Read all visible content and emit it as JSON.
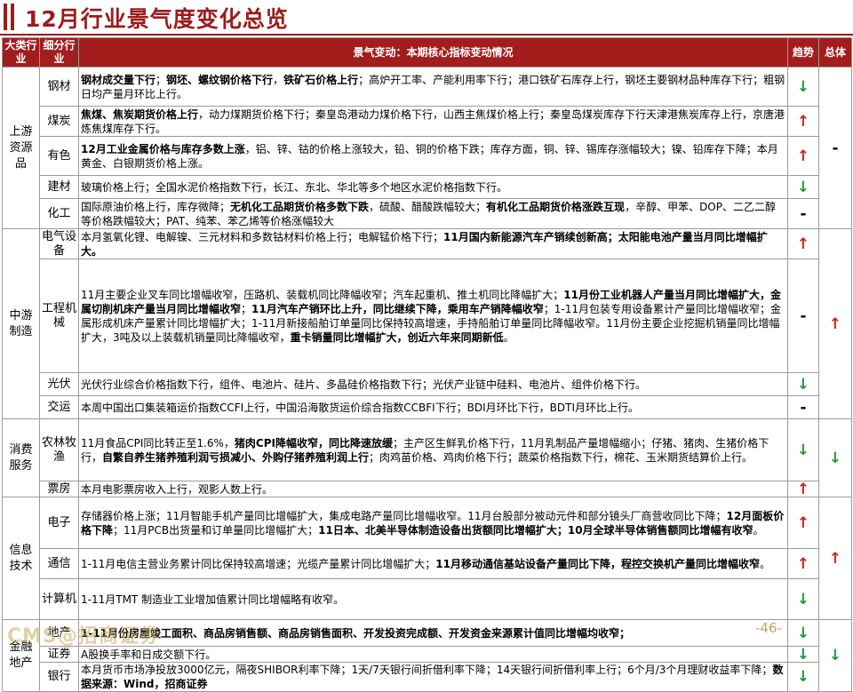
{
  "title": "12月行业景气度变化总览",
  "header": {
    "major": "大类行业",
    "minor": "细分行业",
    "desc": "景气变动：本期核心指标变动情况",
    "trend": "趋势",
    "total": "总体"
  },
  "rows": [
    {
      "major": "上游资源品",
      "major_span": 5,
      "minor": "钢材",
      "h": 44,
      "trend": "↓",
      "trend_class": "down",
      "total": "-",
      "total_class": "flat",
      "total_span": 5,
      "segs": [
        {
          "t": "钢材成交量下行",
          "b": true
        },
        {
          "t": "；",
          "b": false
        },
        {
          "t": "钢坯、螺纹钢价格下行",
          "b": true
        },
        {
          "t": "，",
          "b": false
        },
        {
          "t": "铁矿石价格上行",
          "b": true
        },
        {
          "t": "；高炉开工率、产能利用率下行；港口铁矿石库存上行，钢坯主要钢材品种库存下行；粗钢日均产量月环比上行。",
          "b": false
        }
      ]
    },
    {
      "minor": "煤炭",
      "h": 34,
      "trend": "↑",
      "trend_class": "up",
      "segs": [
        {
          "t": "焦煤、焦炭期货价格上行",
          "b": true
        },
        {
          "t": "，动力煤期货价格下行；秦皇岛港动力煤价格下行，山西主焦煤价格上行；秦皇岛煤炭库存下行天津港焦炭库存上行，京唐港炼焦煤库存下行。",
          "b": false
        }
      ]
    },
    {
      "minor": "有色",
      "h": 44,
      "trend": "↑",
      "trend_class": "up",
      "segs": [
        {
          "t": "12月工业金属价格与库存多数上涨",
          "b": true
        },
        {
          "t": "，铝、锌、钴的价格上涨较大，铅、铜的价格下跌；库存方面，铜、锌、锡库存涨幅较大；镍、铅库存下降；本月黄金、白银期货价格上涨。",
          "b": false
        }
      ]
    },
    {
      "minor": "建材",
      "h": 26,
      "trend": "↓",
      "trend_class": "down",
      "segs": [
        {
          "t": "玻璃价格上行；全国水泥价格指数下行，长江、东北、华北等多个地区水泥价格指数下行。",
          "b": false
        }
      ]
    },
    {
      "minor": "化工",
      "h": 34,
      "trend": "-",
      "trend_class": "flat",
      "segs": [
        {
          "t": "国际原油价格上行，库存微降；",
          "b": false
        },
        {
          "t": "无机化工品期货价格多数下跌",
          "b": true
        },
        {
          "t": "，硫酸、醋酸跌幅较大；",
          "b": false
        },
        {
          "t": "有机化工品期货价格涨跌互现",
          "b": true
        },
        {
          "t": "，辛醇、甲苯、DOP、二乙二醇等价格跌幅较大；PAT、纯苯、苯乙烯等价格涨幅较大",
          "b": false
        }
      ]
    },
    {
      "major": "中游制造",
      "major_span": 4,
      "minor": "电气设备",
      "h": 34,
      "trend": "↑",
      "trend_class": "up",
      "total": "↑",
      "total_class": "up",
      "total_span": 4,
      "segs": [
        {
          "t": "本月氢氧化锂、电解镍、三元材料和多数钴材料价格上行；电解锰价格下行；",
          "b": false
        },
        {
          "t": "11月国内新能源汽车产销续创新高；太阳能电池产量当月同比增幅扩大。",
          "b": true
        }
      ]
    },
    {
      "minor": "工程机械",
      "h": 128,
      "trend": "-",
      "trend_class": "flat",
      "segs": [
        {
          "t": "11月主要企业叉车同比增幅收窄，压路机、装载机同比降幅收窄；汽车起重机、推土机同比降幅扩大；",
          "b": false
        },
        {
          "t": "11月份工业机器人产量当月同比增幅扩大，金属切削机床产量当月同比增幅收窄",
          "b": true
        },
        {
          "t": "；",
          "b": false
        },
        {
          "t": "11月汽车产销环比上升，同比继续下降，乘用车产销降幅收窄",
          "b": true
        },
        {
          "t": "；1-11月包装专用设备累计产量同比增幅收窄；金属形成机床产量累计同比增幅扩大；1-11月新接船舶订单量同比保持较高增速，手持船舶订单量同比降幅收窄。11月份主要企业挖掘机销量同比增幅扩大，3吨及以上装载机销量同比降幅收窄，",
          "b": false
        },
        {
          "t": "重卡销量同比增幅扩大，创近六年来同期新低",
          "b": true
        },
        {
          "t": "。",
          "b": false
        }
      ]
    },
    {
      "minor": "光伏",
      "h": 26,
      "trend": "↓",
      "trend_class": "down",
      "segs": [
        {
          "t": "光伏行业综合价格指数下行，组件、电池片、硅片、多晶硅价格指数下行；光伏产业链中硅料、电池片、组件价格下行。",
          "b": false
        }
      ]
    },
    {
      "minor": "交运",
      "h": 26,
      "trend": "-",
      "trend_class": "flat",
      "segs": [
        {
          "t": "本周中国出口集装箱运价指数CCFI上行，中国沿海散货运价综合指数CCBFI下行；BDI月环比下行，BDTI月环比上行。",
          "b": false
        }
      ]
    },
    {
      "major": "消费服务",
      "major_span": 2,
      "minor": "农林牧渔",
      "h": 70,
      "trend": "↓",
      "trend_class": "down",
      "total": "↓",
      "total_class": "down",
      "total_span": 2,
      "segs": [
        {
          "t": "11月食品CPI同比转正至1.6%，",
          "b": false
        },
        {
          "t": "猪肉CPI降幅收窄，同比降速放缓",
          "b": true
        },
        {
          "t": "；主产区生鲜乳价格下行，11月乳制品产量增幅缩小；仔猪、猪肉、生猪价格下行，",
          "b": false
        },
        {
          "t": "自繁自养生猪养殖利润亏损减小、外购仔猪养殖利润上行",
          "b": true
        },
        {
          "t": "；肉鸡苗价格、鸡肉价格下行；蔬菜价格指数下行，棉花、玉米期货结算价上行。",
          "b": false
        }
      ]
    },
    {
      "minor": "票房",
      "h": 18,
      "trend": "↑",
      "trend_class": "up",
      "segs": [
        {
          "t": "本月电影票房收入上行，观影人数上行。",
          "b": false
        }
      ]
    },
    {
      "major": "信息技术",
      "major_span": 3,
      "minor": "电子",
      "h": 58,
      "trend": "↑",
      "trend_class": "up",
      "total": "↑",
      "total_class": "up",
      "total_span": 3,
      "segs": [
        {
          "t": "存储器价格上涨；11月智能手机产量同比增幅扩大，集成电路产量同比增幅收窄。11月台股部分被动元件和部分镜头厂商营收同比下降；",
          "b": false
        },
        {
          "t": "12月面板价格下降",
          "b": true
        },
        {
          "t": "；11月PCB出货量和订单量同比增幅扩大；",
          "b": false
        },
        {
          "t": "11日本、北美半导体制造设备出货额同比增幅扩大；10月全球半导体销售额同比增幅有收窄",
          "b": true
        },
        {
          "t": "。",
          "b": false
        }
      ]
    },
    {
      "minor": "通信",
      "h": 34,
      "trend": "↑",
      "trend_class": "up",
      "segs": [
        {
          "t": "1-11月电信主营业务累计同比保持较高增速；光缆产量累计同比增幅扩大；",
          "b": false
        },
        {
          "t": "11月移动通信基站设备产量同比下降，程控交换机产量同比增幅收窄",
          "b": true
        },
        {
          "t": "。",
          "b": false
        }
      ]
    },
    {
      "minor": "计算机",
      "h": 46,
      "trend": "↓",
      "trend_class": "down",
      "segs": [
        {
          "t": "1-11月TMT 制造业工业增加值累计同比增幅略有收窄。",
          "b": false
        }
      ]
    },
    {
      "major": "金融地产",
      "major_span": 3,
      "minor": "地产",
      "h": 30,
      "trend": "↓",
      "trend_class": "down",
      "total": "↓",
      "total_class": "down",
      "total_span": 3,
      "segs": [
        {
          "t": "1-11月份房屋竣工面积、商品房销售额、商品房销售面积、开发投资完成额、开发资金来源累计值同比增幅均收窄；",
          "b": true
        }
      ]
    },
    {
      "minor": "证券",
      "h": 18,
      "trend": "↓",
      "trend_class": "down",
      "segs": [
        {
          "t": "A股换手率和日成交额下行。",
          "b": false
        }
      ]
    },
    {
      "minor": "银行",
      "h": 30,
      "trend": "↓",
      "trend_class": "down",
      "segs": [
        {
          "t": "本月货币市场净投放3000亿元，隔夜SHIBOR利率下降；1天/7天银行间折借利率下降；14天银行间折借利率上行；6个月/3个月理财收益率下降；",
          "b": false
        },
        {
          "t": "数据来源：Wind，招商证券",
          "b": true
        }
      ]
    }
  ],
  "footer": {
    "logo": "CMS@招商证券",
    "page": "-46-"
  }
}
